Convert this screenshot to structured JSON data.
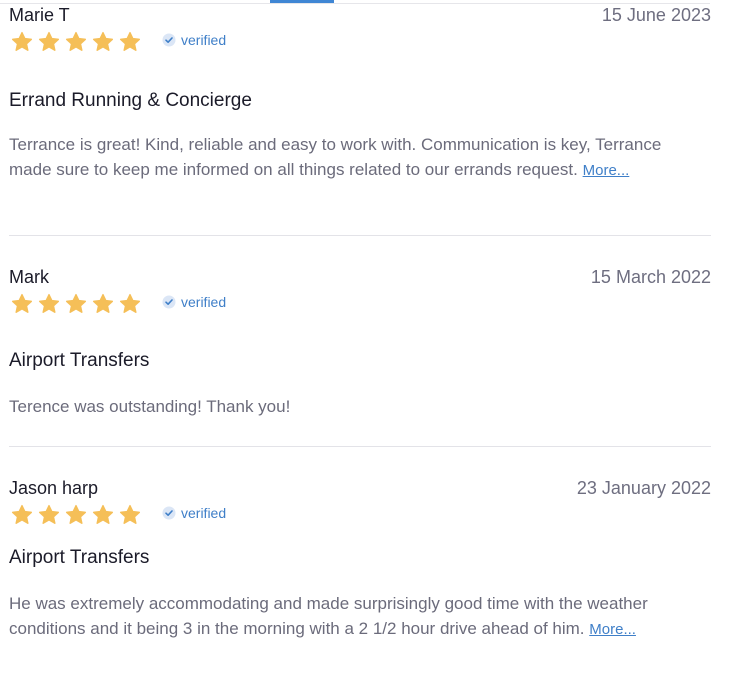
{
  "colors": {
    "star": "#f5bf58",
    "verified": "#3f7fc8",
    "link": "#3f7fc8",
    "accent_tab": "#3f86d4"
  },
  "icons": {
    "star": "star-icon",
    "verified": "check-circle-icon"
  },
  "reviews": [
    {
      "name": "Marie T",
      "date": "15 June 2023",
      "rating": 5,
      "verified_label": "verified",
      "service": "Errand Running & Concierge",
      "text": "Terrance is great! Kind, reliable and easy to work with. Communication is key, Terrance made sure to keep me informed on all things related to our errands request.",
      "more_label": "More..."
    },
    {
      "name": "Mark",
      "date": "15 March 2022",
      "rating": 5,
      "verified_label": "verified",
      "service": "Airport Transfers",
      "text": "Terence was outstanding! Thank you!"
    },
    {
      "name": "Jason harp",
      "date": "23 January 2022",
      "rating": 5,
      "verified_label": "verified",
      "service": "Airport Transfers",
      "text": "He was extremely accommodating and made surprisingly good time with the weather conditions and it being 3 in the morning with a 2 1/2 hour drive ahead of him.",
      "more_label": "More..."
    }
  ]
}
